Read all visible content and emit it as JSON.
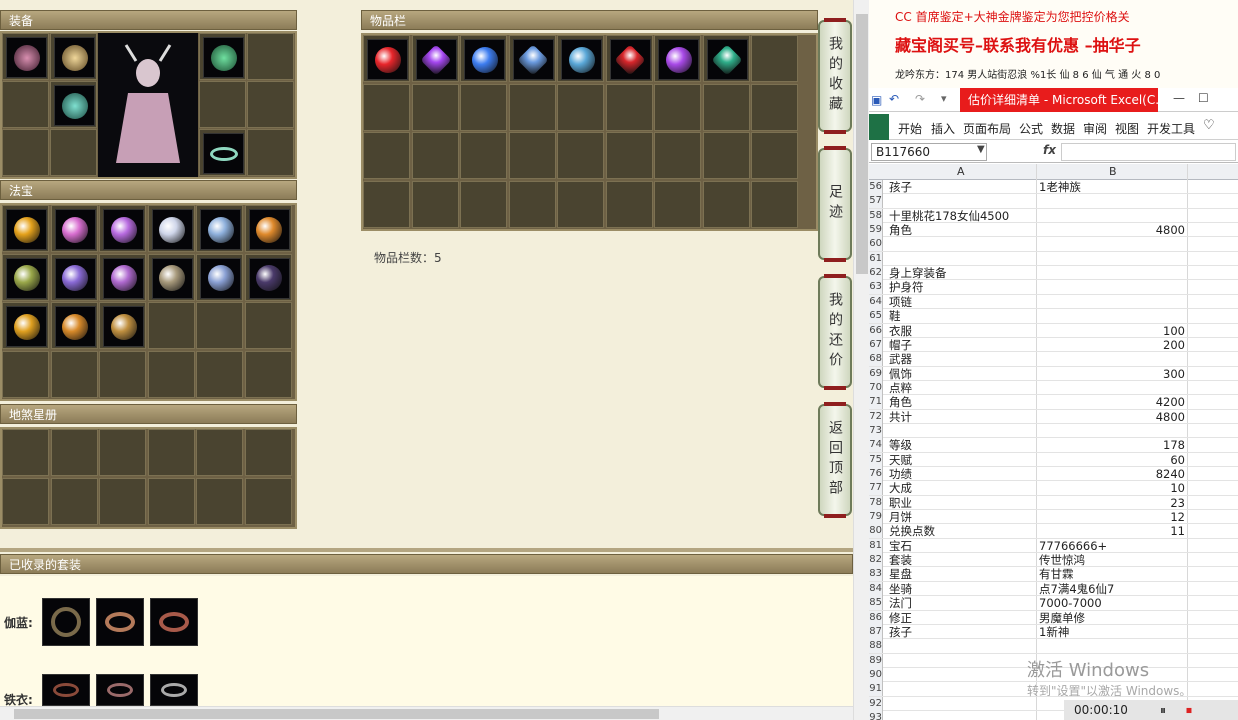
{
  "game": {
    "equip_title": "装备",
    "fabao_title": "法宝",
    "disha_title": "地煞星册",
    "item_title": "物品栏",
    "item_count_label": "物品栏数：5",
    "collected_title": "已收录的套装",
    "set1_label": "伽蓝:",
    "set2_label": "铁衣:",
    "side_buttons": [
      "我的收藏",
      "足迹",
      "我的还价",
      "返回顶部"
    ],
    "gem_colors": [
      "#e8262b",
      "#a547f0",
      "#3d7df0",
      "#6b9be0",
      "#5aa8d8",
      "#d8262b",
      "#a94ae8",
      "#2fae8a"
    ],
    "fabao_colors": [
      "#e5a21c",
      "#d86ed0",
      "#b86be0",
      "#cfd6ea",
      "#8fb1dd",
      "#e08a2c",
      "#9aa84a",
      "#8a6ad6",
      "#b06ad0",
      "#a89a7c",
      "#8aa0d4",
      "#4a3a6a",
      "#e0a020",
      "#d88a2a",
      "#c09040"
    ]
  },
  "right": {
    "notice": {
      "line1": "CC 首席鉴定+大神金牌鉴定为您把控价格关",
      "line2": "藏宝阁买号–联系我有优惠 –抽华子",
      "line3": "龙吟东方：174 男人站街忍浪 %1长 仙 8 6 仙 气 通 火 8 0"
    },
    "excel": {
      "window_title": "估价详细清单 - Microsoft Excel(C...",
      "ribbon_tabs": [
        "开始",
        "插入",
        "页面布局",
        "公式",
        "数据",
        "审阅",
        "视图",
        "开发工具"
      ],
      "name_box": "B117660",
      "fx": "fx",
      "col_a": "A",
      "col_b": "B",
      "rows": [
        {
          "n": "56",
          "a": "孩子",
          "b": "1老神族",
          "num": false
        },
        {
          "n": "57",
          "a": "",
          "b": "",
          "num": false
        },
        {
          "n": "58",
          "a": "十里桃花178女仙4500",
          "b": "",
          "num": false
        },
        {
          "n": "59",
          "a": "角色",
          "b": "4800",
          "num": true
        },
        {
          "n": "60",
          "a": "",
          "b": "",
          "num": false
        },
        {
          "n": "61",
          "a": "",
          "b": "",
          "num": false
        },
        {
          "n": "62",
          "a": "身上穿装备",
          "b": "",
          "num": false
        },
        {
          "n": "63",
          "a": "护身符",
          "b": "",
          "num": false
        },
        {
          "n": "64",
          "a": "项链",
          "b": "",
          "num": false
        },
        {
          "n": "65",
          "a": "鞋",
          "b": "",
          "num": false
        },
        {
          "n": "66",
          "a": "衣服",
          "b": "100",
          "num": true
        },
        {
          "n": "67",
          "a": "帽子",
          "b": "200",
          "num": true
        },
        {
          "n": "68",
          "a": "武器",
          "b": "",
          "num": false
        },
        {
          "n": "69",
          "a": "佩饰",
          "b": "300",
          "num": true
        },
        {
          "n": "70",
          "a": "点粹",
          "b": "",
          "num": false
        },
        {
          "n": "71",
          "a": "角色",
          "b": "4200",
          "num": true
        },
        {
          "n": "72",
          "a": "共计",
          "b": "4800",
          "num": true
        },
        {
          "n": "73",
          "a": "",
          "b": "",
          "num": false
        },
        {
          "n": "74",
          "a": "等级",
          "b": "178",
          "num": true
        },
        {
          "n": "75",
          "a": "天赋",
          "b": "60",
          "num": true
        },
        {
          "n": "76",
          "a": "功绩",
          "b": "8240",
          "num": true
        },
        {
          "n": "77",
          "a": "大成",
          "b": "10",
          "num": true
        },
        {
          "n": "78",
          "a": "职业",
          "b": "23",
          "num": true
        },
        {
          "n": "79",
          "a": "月饼",
          "b": "12",
          "num": true
        },
        {
          "n": "80",
          "a": "兑换点数",
          "b": "11",
          "num": true
        },
        {
          "n": "81",
          "a": "宝石",
          "b": "77766666+",
          "num": false
        },
        {
          "n": "82",
          "a": "套装",
          "b": "传世惊鸿",
          "num": false
        },
        {
          "n": "83",
          "a": "星盘",
          "b": "有甘霖",
          "num": false
        },
        {
          "n": "84",
          "a": "坐骑",
          "b": "点7满4鬼6仙7",
          "num": false
        },
        {
          "n": "85",
          "a": "法门",
          "b": "7000-7000",
          "num": false
        },
        {
          "n": "86",
          "a": "修正",
          "b": "男魔单修",
          "num": false
        },
        {
          "n": "87",
          "a": "孩子",
          "b": "1新神",
          "num": false
        },
        {
          "n": "88",
          "a": "",
          "b": "",
          "num": false
        },
        {
          "n": "89",
          "a": "",
          "b": "",
          "num": false
        },
        {
          "n": "90",
          "a": "",
          "b": "",
          "num": false
        },
        {
          "n": "91",
          "a": "",
          "b": "",
          "num": false
        },
        {
          "n": "92",
          "a": "",
          "b": "",
          "num": false
        },
        {
          "n": "93",
          "a": "",
          "b": "",
          "num": false
        }
      ],
      "watermark": "激活 Windows",
      "watermark_sub": "转到\"设置\"以激活 Windows。",
      "timer": "00:00:10"
    }
  }
}
